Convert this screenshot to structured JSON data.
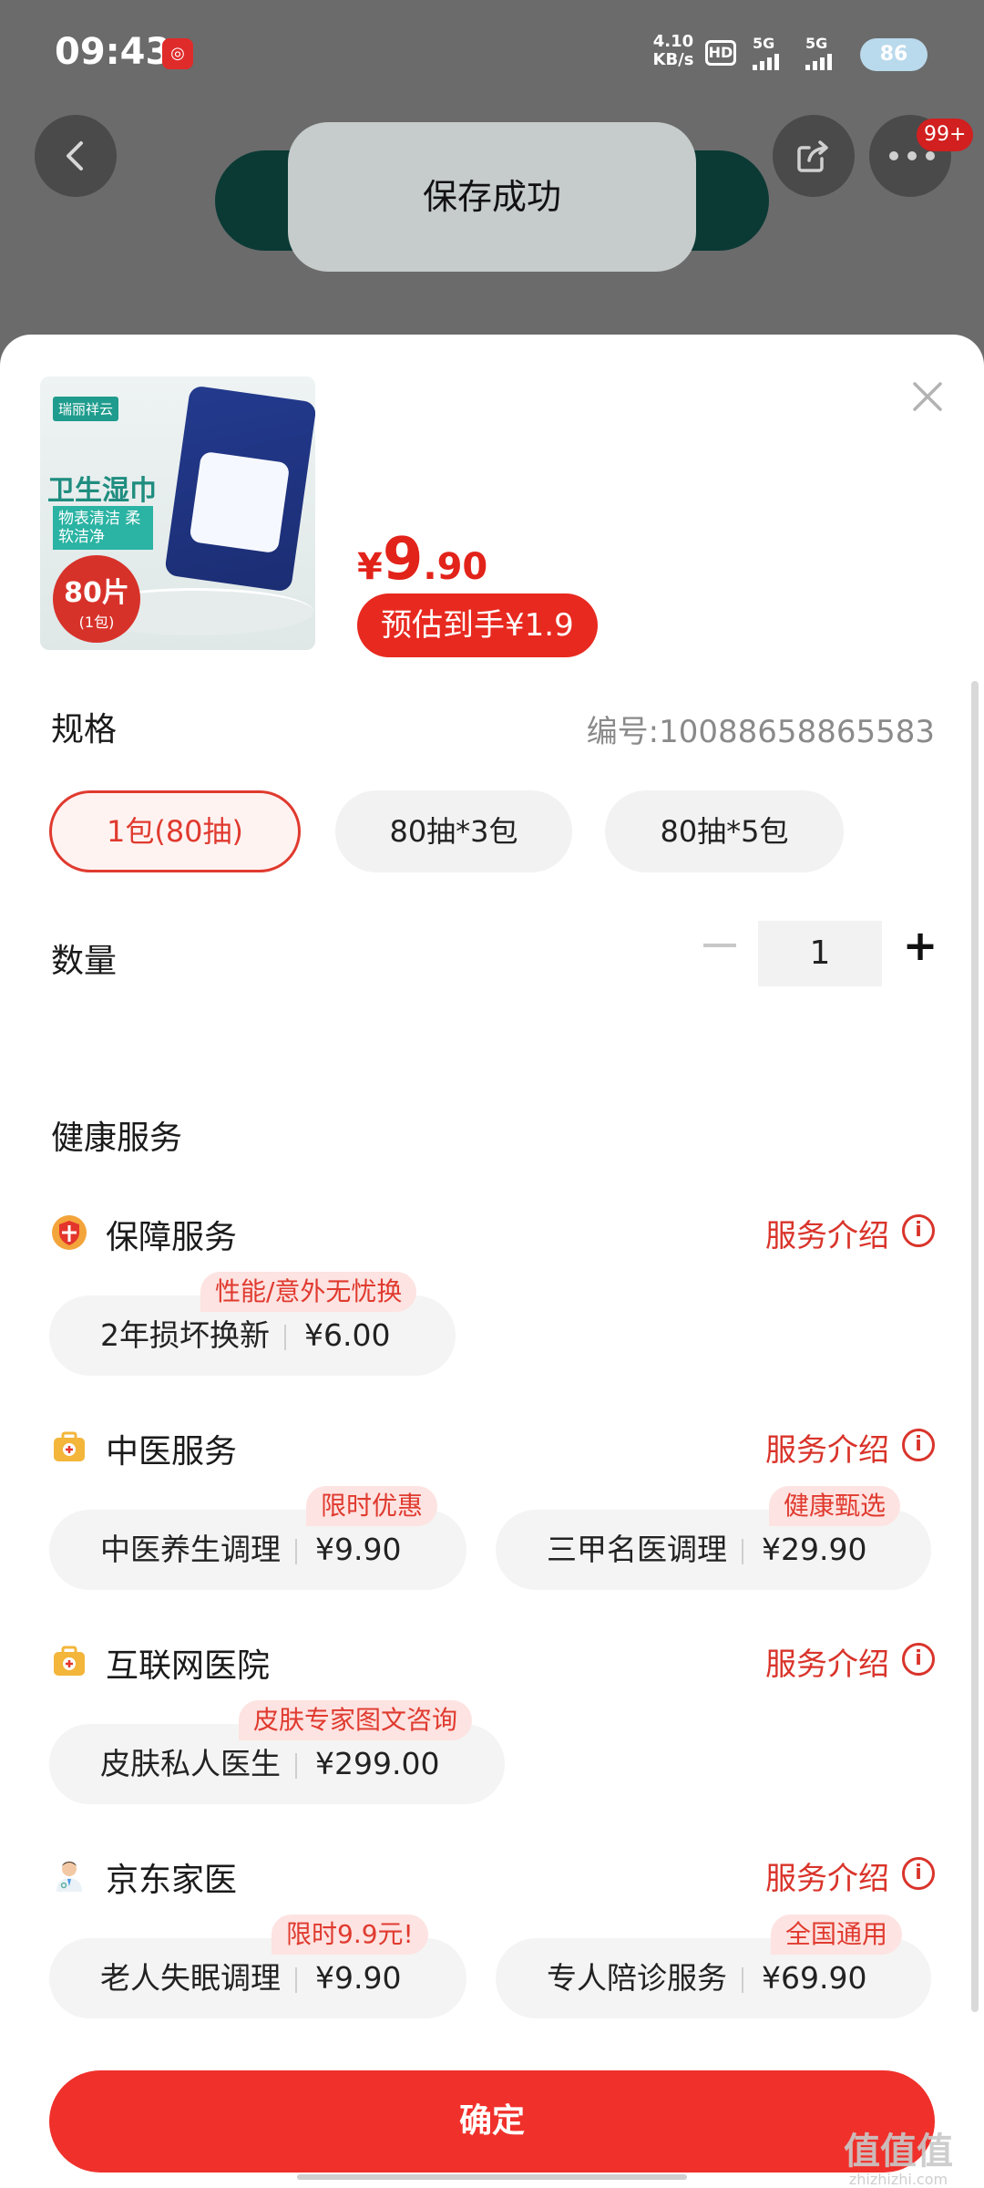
{
  "status_bar": {
    "time": "09:43",
    "net_speed_value": "4.10",
    "net_speed_unit": "KB/s",
    "hd": "HD",
    "signal1": "5G",
    "signal2": "5G",
    "battery": "86"
  },
  "header": {
    "notification_badge": "99+"
  },
  "toast": {
    "text": "保存成功"
  },
  "product": {
    "image": {
      "brand": "瑞丽祥云",
      "title": "卫生湿巾",
      "subtitle": "物表清洁 柔软洁净",
      "count": "80片",
      "count_unit": "(1包)"
    },
    "price_symbol": "¥",
    "price_int": "9",
    "price_dec": ".90",
    "estimate": "预估到手¥1.9"
  },
  "spec": {
    "label": "规格",
    "code": "编号:10088658865583",
    "options": [
      {
        "label": "1包(80抽)",
        "selected": true
      },
      {
        "label": "80抽*3包",
        "selected": false
      },
      {
        "label": "80抽*5包",
        "selected": false
      }
    ]
  },
  "quantity": {
    "label": "数量",
    "value": "1",
    "minus": "−",
    "plus": "+"
  },
  "health": {
    "title": "健康服务",
    "intro_label": "服务介绍",
    "groups": [
      {
        "icon": "shield-icon",
        "title": "保障服务",
        "items": [
          {
            "name": "2年损坏换新",
            "price": "¥6.00",
            "tag": "性能/意外无忧换"
          }
        ]
      },
      {
        "icon": "medical-kit-icon",
        "title": "中医服务",
        "items": [
          {
            "name": "中医养生调理",
            "price": "¥9.90",
            "tag": "限时优惠"
          },
          {
            "name": "三甲名医调理",
            "price": "¥29.90",
            "tag": "健康甄选"
          }
        ]
      },
      {
        "icon": "medical-kit-icon",
        "title": "互联网医院",
        "items": [
          {
            "name": "皮肤私人医生",
            "price": "¥299.00",
            "tag": "皮肤专家图文咨询"
          }
        ]
      },
      {
        "icon": "doctor-icon",
        "title": "京东家医",
        "items": [
          {
            "name": "老人失眠调理",
            "price": "¥9.90",
            "tag": "限时9.9元!"
          },
          {
            "name": "专人陪诊服务",
            "price": "¥69.90",
            "tag": "全国通用"
          }
        ]
      }
    ]
  },
  "footer": {
    "confirm": "确定",
    "watermark": "值值值",
    "watermark_url": "zhizhizhi.com"
  },
  "colors": {
    "accent": "#e8291f",
    "tag_bg": "#fde3e1",
    "toast_bg": "#c6cbcb"
  }
}
